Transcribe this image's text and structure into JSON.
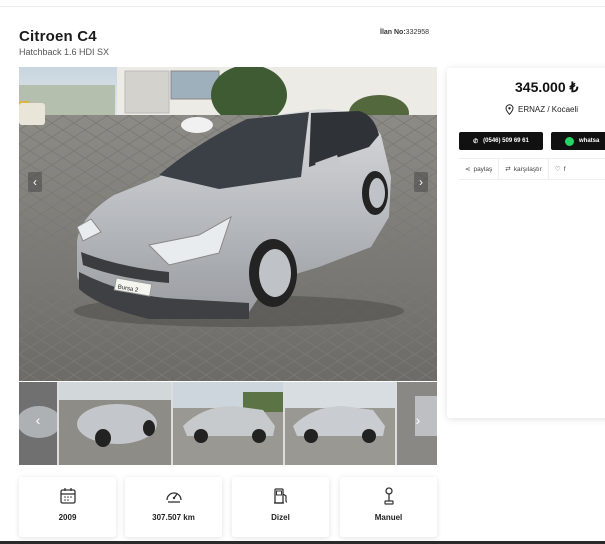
{
  "listing": {
    "title": "Citroen C4",
    "subtitle": "Hatchback 1.6 HDI SX",
    "ilan_label": "İlan No:",
    "ilan_no": "332958"
  },
  "gallery": {
    "prev_icon": "chevron-left-icon",
    "next_icon": "chevron-right-icon",
    "plate_text": "Bursa 2"
  },
  "specs": [
    {
      "icon": "calendar-icon",
      "value": "2009"
    },
    {
      "icon": "speedometer-icon",
      "value": "307.507 km"
    },
    {
      "icon": "fuel-pump-icon",
      "value": "Dizel"
    },
    {
      "icon": "gear-shift-icon",
      "value": "Manuel"
    }
  ],
  "panel": {
    "price": "345.000 ₺",
    "location": "ERNAZ / Kocaeli",
    "phone": "(0546) 509 69 61",
    "whatsapp": "whatsa",
    "share": "paylaş",
    "compare": "karşılaştır",
    "favorite": "f"
  },
  "colors": {
    "button_bg": "#111111",
    "whatsapp_green": "#25d366"
  }
}
